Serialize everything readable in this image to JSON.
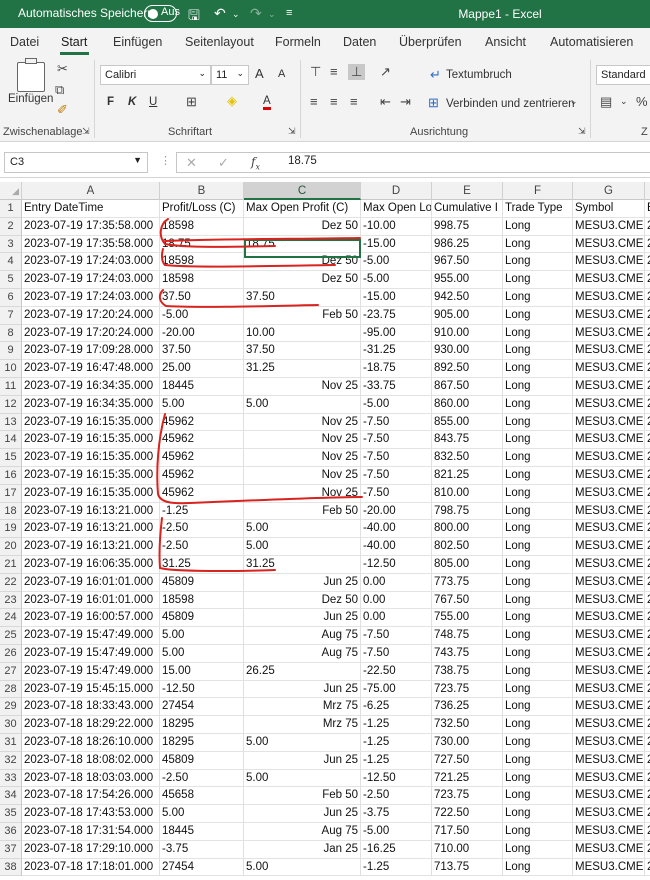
{
  "titlebar": {
    "autosave_label": "Automatisches Speichern",
    "autosave_state": "Aus",
    "document_title": "Mappe1  -  Excel"
  },
  "menu": {
    "tabs": [
      "Datei",
      "Start",
      "Einfügen",
      "Seitenlayout",
      "Formeln",
      "Daten",
      "Überprüfen",
      "Ansicht",
      "Automatisieren"
    ],
    "active": "Start"
  },
  "ribbon": {
    "paste_label": "Einfügen",
    "clipboard_label": "Zwischenablage",
    "font_label": "Schriftart",
    "alignment_label": "Ausrichtung",
    "font_name": "Calibri",
    "font_size": "11",
    "wrap_text_label": "Textumbruch",
    "merge_center_label": "Verbinden und zentrieren",
    "number_format": "Standard",
    "bold_label": "F",
    "italic_label": "K",
    "underline_label": "U",
    "font_grow_label": "A",
    "font_shrink_label": "A",
    "font_color_label": "A",
    "number_group_label": "Z"
  },
  "formula_bar": {
    "name_box": "C3",
    "value": "18.75"
  },
  "columns": [
    "A",
    "B",
    "C",
    "D",
    "E",
    "F",
    "G"
  ],
  "selected_column": "C",
  "header_row": [
    "Entry DateTime",
    "Profit/Loss (C)",
    "Max Open Profit (C)",
    "Max Open Lo",
    "Cumulative I",
    "Trade Type",
    "Symbol"
  ],
  "rows": [
    [
      "2023-07-19  17:35:58.000",
      "18598",
      "Dez 50",
      "-10.00",
      "998.75",
      "Long",
      "MESU3.CME"
    ],
    [
      "2023-07-19  17:35:58.000",
      "18.75",
      "18.75",
      "-15.00",
      "986.25",
      "Long",
      "MESU3.CME"
    ],
    [
      "2023-07-19  17:24:03.000",
      "18598",
      "Dez 50",
      "-5.00",
      "967.50",
      "Long",
      "MESU3.CME"
    ],
    [
      "2023-07-19  17:24:03.000",
      "18598",
      "Dez 50",
      "-5.00",
      "955.00",
      "Long",
      "MESU3.CME"
    ],
    [
      "2023-07-19  17:24:03.000",
      "37.50",
      "37.50",
      "-15.00",
      "942.50",
      "Long",
      "MESU3.CME"
    ],
    [
      "2023-07-19  17:20:24.000",
      "-5.00",
      "Feb 50",
      "-23.75",
      "905.00",
      "Long",
      "MESU3.CME"
    ],
    [
      "2023-07-19  17:20:24.000",
      "-20.00",
      "10.00",
      "-95.00",
      "910.00",
      "Long",
      "MESU3.CME"
    ],
    [
      "2023-07-19  17:09:28.000",
      "37.50",
      "37.50",
      "-31.25",
      "930.00",
      "Long",
      "MESU3.CME"
    ],
    [
      "2023-07-19  16:47:48.000",
      "25.00",
      "31.25",
      "-18.75",
      "892.50",
      "Long",
      "MESU3.CME"
    ],
    [
      "2023-07-19  16:34:35.000",
      "18445",
      "Nov 25",
      "-33.75",
      "867.50",
      "Long",
      "MESU3.CME"
    ],
    [
      "2023-07-19  16:34:35.000",
      "5.00",
      "5.00",
      "-5.00",
      "860.00",
      "Long",
      "MESU3.CME"
    ],
    [
      "2023-07-19  16:15:35.000",
      "45962",
      "Nov 25",
      "-7.50",
      "855.00",
      "Long",
      "MESU3.CME"
    ],
    [
      "2023-07-19  16:15:35.000",
      "45962",
      "Nov 25",
      "-7.50",
      "843.75",
      "Long",
      "MESU3.CME"
    ],
    [
      "2023-07-19  16:15:35.000",
      "45962",
      "Nov 25",
      "-7.50",
      "832.50",
      "Long",
      "MESU3.CME"
    ],
    [
      "2023-07-19  16:15:35.000",
      "45962",
      "Nov 25",
      "-7.50",
      "821.25",
      "Long",
      "MESU3.CME"
    ],
    [
      "2023-07-19  16:15:35.000",
      "45962",
      "Nov 25",
      "-7.50",
      "810.00",
      "Long",
      "MESU3.CME"
    ],
    [
      "2023-07-19  16:13:21.000",
      "-1.25",
      "Feb 50",
      "-20.00",
      "798.75",
      "Long",
      "MESU3.CME"
    ],
    [
      "2023-07-19  16:13:21.000",
      "-2.50",
      "5.00",
      "-40.00",
      "800.00",
      "Long",
      "MESU3.CME"
    ],
    [
      "2023-07-19  16:13:21.000",
      "-2.50",
      "5.00",
      "-40.00",
      "802.50",
      "Long",
      "MESU3.CME"
    ],
    [
      "2023-07-19  16:06:35.000",
      "31.25",
      "31.25",
      "-12.50",
      "805.00",
      "Long",
      "MESU3.CME"
    ],
    [
      "2023-07-19  16:01:01.000",
      "45809",
      "Jun 25",
      "0.00",
      "773.75",
      "Long",
      "MESU3.CME"
    ],
    [
      "2023-07-19  16:01:01.000",
      "18598",
      "Dez 50",
      "0.00",
      "767.50",
      "Long",
      "MESU3.CME"
    ],
    [
      "2023-07-19  16:00:57.000",
      "45809",
      "Jun 25",
      "0.00",
      "755.00",
      "Long",
      "MESU3.CME"
    ],
    [
      "2023-07-19  15:47:49.000",
      "5.00",
      "Aug 75",
      "-7.50",
      "748.75",
      "Long",
      "MESU3.CME"
    ],
    [
      "2023-07-19  15:47:49.000",
      "5.00",
      "Aug 75",
      "-7.50",
      "743.75",
      "Long",
      "MESU3.CME"
    ],
    [
      "2023-07-19  15:47:49.000",
      "15.00",
      "26.25",
      "-22.50",
      "738.75",
      "Long",
      "MESU3.CME"
    ],
    [
      "2023-07-19  15:45:15.000",
      "-12.50",
      "Jun 25",
      "-75.00",
      "723.75",
      "Long",
      "MESU3.CME"
    ],
    [
      "2023-07-18  18:33:43.000",
      "27454",
      "Mrz 75",
      "-6.25",
      "736.25",
      "Long",
      "MESU3.CME"
    ],
    [
      "2023-07-18  18:29:22.000",
      "18295",
      "Mrz 75",
      "-1.25",
      "732.50",
      "Long",
      "MESU3.CME"
    ],
    [
      "2023-07-18  18:26:10.000",
      "18295",
      "5.00",
      "-1.25",
      "730.00",
      "Long",
      "MESU3.CME"
    ],
    [
      "2023-07-18  18:08:02.000",
      "45809",
      "Jun 25",
      "-1.25",
      "727.50",
      "Long",
      "MESU3.CME"
    ],
    [
      "2023-07-18  18:03:03.000",
      "-2.50",
      "5.00",
      "-12.50",
      "721.25",
      "Long",
      "MESU3.CME"
    ],
    [
      "2023-07-18  17:54:26.000",
      "45658",
      "Feb 50",
      "-2.50",
      "723.75",
      "Long",
      "MESU3.CME"
    ],
    [
      "2023-07-18  17:43:53.000",
      "5.00",
      "Jun 25",
      "-3.75",
      "722.50",
      "Long",
      "MESU3.CME"
    ],
    [
      "2023-07-18  17:31:54.000",
      "18445",
      "Aug 75",
      "-5.00",
      "717.50",
      "Long",
      "MESU3.CME"
    ],
    [
      "2023-07-18  17:29:10.000",
      "-3.75",
      "Jan 25",
      "-16.25",
      "710.00",
      "Long",
      "MESU3.CME"
    ],
    [
      "2023-07-18  17:18:01.000",
      "27454",
      "5.00",
      "-1.25",
      "713.75",
      "Long",
      "MESU3.CME"
    ]
  ],
  "row_numbers": [
    "1",
    "2",
    "3",
    "4",
    "5",
    "6",
    "7",
    "8",
    "9",
    "10",
    "11",
    "12",
    "13",
    "14",
    "15",
    "16",
    "17",
    "18",
    "19",
    "20",
    "21",
    "22",
    "23",
    "24",
    "25",
    "26",
    "27",
    "28",
    "29",
    "30",
    "31",
    "32",
    "33",
    "34",
    "35",
    "36",
    "37",
    "38"
  ],
  "next_column_peek": [
    "E",
    "2",
    "2",
    "2",
    "2",
    "2",
    "2",
    "2",
    "2",
    "2",
    "2",
    "2",
    "2",
    "2",
    "2",
    "2",
    "2",
    "2",
    "2",
    "2",
    "2",
    "2",
    "2",
    "2",
    "2",
    "2",
    "2",
    "2",
    "2",
    "2",
    "2",
    "2",
    "2",
    "2",
    "2",
    "2",
    "2",
    "2"
  ],
  "annotation_color": "#d8231e",
  "accent_color": "#217346"
}
